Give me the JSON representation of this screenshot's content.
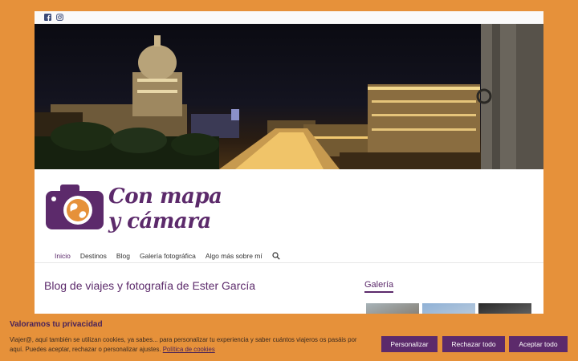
{
  "colors": {
    "background": "#e6913a",
    "brand_purple": "#5c2a6b",
    "button": "#5c2a6b"
  },
  "topbar": {
    "icons": [
      "facebook-icon",
      "instagram-icon"
    ]
  },
  "brand": {
    "title_line1": "Con mapa",
    "title_line2": "y cámara"
  },
  "nav": {
    "items": [
      {
        "label": "Inicio",
        "active": true
      },
      {
        "label": "Destinos"
      },
      {
        "label": "Blog"
      },
      {
        "label": "Galería fotográfica"
      },
      {
        "label": "Algo más sobre mí"
      }
    ],
    "search_icon": "search-icon"
  },
  "main": {
    "post_title": "Blog de viajes y fotografía de Ester García"
  },
  "sidebar": {
    "title": "Galería"
  },
  "cookie": {
    "title": "Valoramos tu privacidad",
    "text": "Viajer@, aquí también se utilizan cookies, ya sabes... para personalizar tu experiencia y saber cuántos viajeros os pasáis por aquí. Puedes aceptar, rechazar o personalizar ajustes.",
    "link": "Política de cookies",
    "customize": "Personalizar",
    "reject": "Rechazar todo",
    "accept": "Aceptar todo"
  }
}
